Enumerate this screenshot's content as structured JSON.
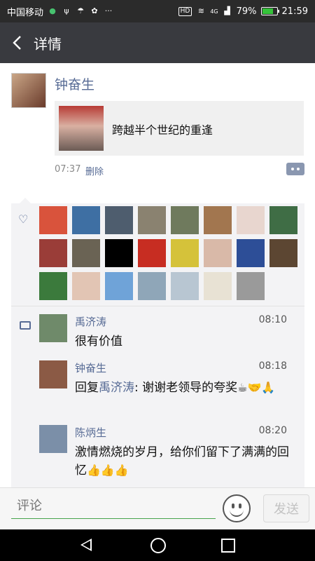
{
  "status_bar": {
    "carrier": "中国移动",
    "network": "4G",
    "battery": "79%",
    "battery_level": 0.79,
    "time": "21:59",
    "icons": [
      "shield-icon",
      "usb-icon",
      "weather-icon",
      "notification-icon",
      "more-dots-icon",
      "hd-icon",
      "wifi-icon",
      "signal-icon",
      "battery-icon"
    ]
  },
  "header": {
    "title": "详情",
    "back_icon": "chevron-left-icon"
  },
  "post": {
    "author": "钟奋生",
    "link_title": "跨越半个世纪的重逢",
    "time": "07:37",
    "delete_label": "删除"
  },
  "likes": {
    "icon": "heart-icon",
    "avatars": [
      {
        "name": "liker-1",
        "color": "#d9533c"
      },
      {
        "name": "liker-2",
        "color": "#3e6fa3"
      },
      {
        "name": "liker-3",
        "color": "#4e5d6e"
      },
      {
        "name": "liker-4",
        "color": "#8a8270"
      },
      {
        "name": "liker-5",
        "color": "#6f7a5d"
      },
      {
        "name": "liker-6",
        "color": "#a2764f"
      },
      {
        "name": "liker-7",
        "color": "#e8d6cf"
      },
      {
        "name": "liker-8",
        "color": "#3f6d45"
      },
      {
        "name": "liker-9",
        "color": "#9a3d38"
      },
      {
        "name": "liker-10",
        "color": "#6a6354"
      },
      {
        "name": "liker-11",
        "color": "#000000"
      },
      {
        "name": "liker-12",
        "color": "#c72d22"
      },
      {
        "name": "liker-13",
        "color": "#d5c23a"
      },
      {
        "name": "liker-14",
        "color": "#d9b9a8"
      },
      {
        "name": "liker-15",
        "color": "#2d4e97"
      },
      {
        "name": "liker-16",
        "color": "#5c4632"
      },
      {
        "name": "liker-17",
        "color": "#3b7a3c"
      },
      {
        "name": "liker-18",
        "color": "#e2c5b4"
      },
      {
        "name": "liker-19",
        "color": "#6fa3d8"
      },
      {
        "name": "liker-20",
        "color": "#8fa6b8"
      },
      {
        "name": "liker-21",
        "color": "#b8c6d2"
      },
      {
        "name": "liker-22",
        "color": "#e8e2d4"
      },
      {
        "name": "liker-23",
        "color": "#9a9a9a"
      }
    ]
  },
  "comments": [
    {
      "name": "禹济涛",
      "time": "08:10",
      "text": "很有价值",
      "reply_prefix": "",
      "reply_to": "",
      "text_suffix": "",
      "emojis": "",
      "avatar_color": "#6f8a6a"
    },
    {
      "name": "钟奋生",
      "time": "08:18",
      "text": "",
      "reply_prefix": "回复",
      "reply_to": "禹济涛",
      "text_suffix": ": 谢谢老领导的夸奖",
      "emojis": "☕🤝🙏",
      "avatar_color": "#8b5a45"
    },
    {
      "name": "陈炳生",
      "time": "08:20",
      "text": "激情燃烧的岁月，给你们留下了满满的回忆",
      "reply_prefix": "",
      "reply_to": "",
      "text_suffix": "",
      "emojis": "👍👍👍",
      "avatar_color": "#7b8fa8"
    }
  ],
  "input_bar": {
    "placeholder": "评论",
    "emoji_icon": "smiley-icon",
    "send_label": "发送"
  },
  "nav_bar": {
    "icons": [
      "back-triangle-icon",
      "home-circle-icon",
      "recent-square-icon"
    ]
  },
  "colors": {
    "link_blue": "#576b95",
    "title_bar": "#393a3f",
    "accent_green": "#47a34c"
  }
}
